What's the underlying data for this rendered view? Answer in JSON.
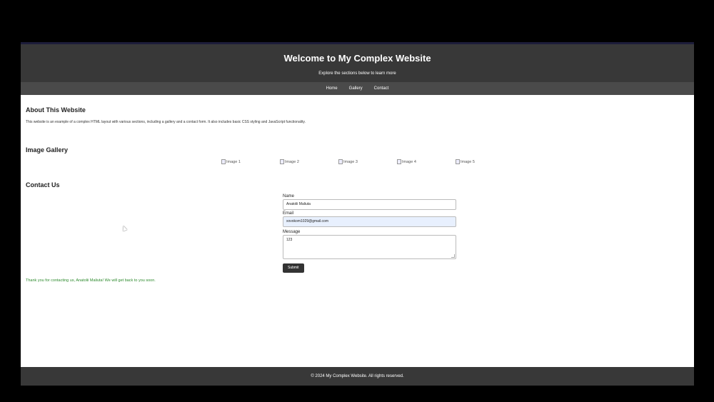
{
  "header": {
    "title": "Welcome to My Complex Website",
    "subtitle": "Explore the sections below to learn more"
  },
  "nav": {
    "items": [
      "Home",
      "Gallery",
      "Contact"
    ]
  },
  "about": {
    "heading": "About This Website",
    "text": "This website is an example of a complex HTML layout with various sections, including a gallery and a contact form. It also includes basic CSS styling and JavaScript functionality."
  },
  "gallery": {
    "heading": "Image Gallery",
    "images": [
      "Image 1",
      "Image 2",
      "Image 3",
      "Image 4",
      "Image 5"
    ]
  },
  "contact": {
    "heading": "Contact Us",
    "name_label": "Name",
    "name_value": "Anatolii Maliuta",
    "email_label": "Email",
    "email_value": "xovokom1029@gmail.com",
    "message_label": "Message",
    "message_value": "123",
    "submit_label": "Submit",
    "thanks_message": "Thank you for contacting us, Anatolii Maliuta! We will get back to you soon."
  },
  "footer": {
    "text": "© 2024 My Complex Website. All rights reserved."
  },
  "colors": {
    "header_bg": "#383838",
    "nav_bg": "#4a4a4a",
    "success_text": "#2d8a2d",
    "autofill_bg": "#e8f0fe"
  }
}
